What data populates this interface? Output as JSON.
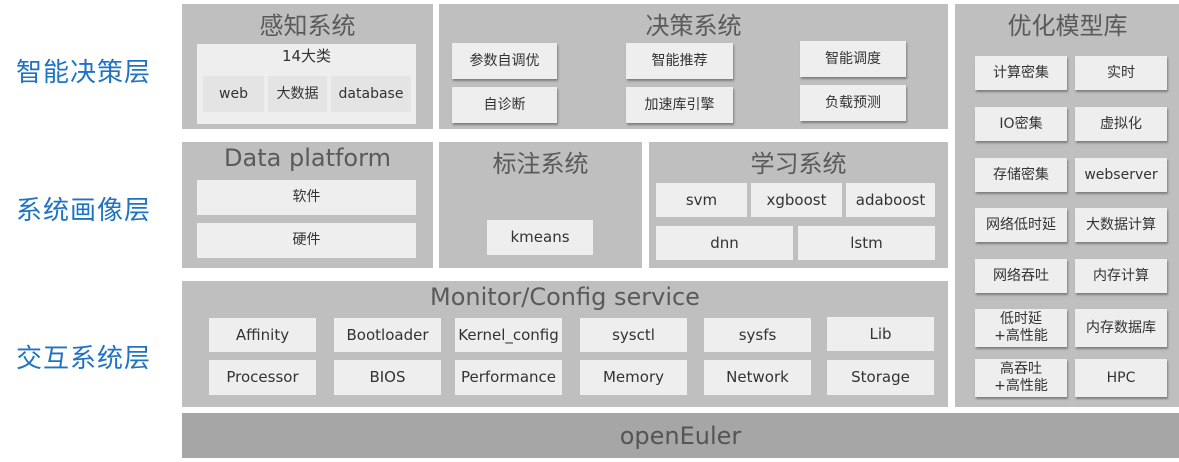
{
  "layers": [
    "智能决策层",
    "系统画像层",
    "交互系统层"
  ],
  "perception": {
    "title": "感知系统",
    "category": "14大类",
    "items": [
      "web",
      "大数据",
      "database"
    ]
  },
  "decision": {
    "title": "决策系统",
    "items": [
      "参数自调优",
      "智能推荐",
      "智能调度",
      "自诊断",
      "加速库引擎",
      "负载预测"
    ]
  },
  "optimization": {
    "title": "优化模型库",
    "items": [
      "计算密集",
      "实时",
      "IO密集",
      "虚拟化",
      "存储密集",
      "webserver",
      "网络低时延",
      "大数据计算",
      "网络吞吐",
      "内存计算",
      "低时延+高性能",
      "内存数据库",
      "高吞吐+高性能",
      "HPC"
    ]
  },
  "data_platform": {
    "title": "Data platform",
    "items": [
      "软件",
      "硬件"
    ]
  },
  "labeling": {
    "title": "标注系统",
    "items": [
      "kmeans"
    ]
  },
  "learning": {
    "title": "学习系统",
    "items": [
      "svm",
      "xgboost",
      "adaboost",
      "dnn",
      "lstm"
    ]
  },
  "monitor": {
    "title": "Monitor/Config service",
    "items": [
      "Affinity",
      "Bootloader",
      "Kernel_config",
      "sysctl",
      "sysfs",
      "Lib",
      "Processor",
      "BIOS",
      "Performance",
      "Memory",
      "Network",
      "Storage"
    ]
  },
  "base": {
    "label": "openEuler"
  }
}
